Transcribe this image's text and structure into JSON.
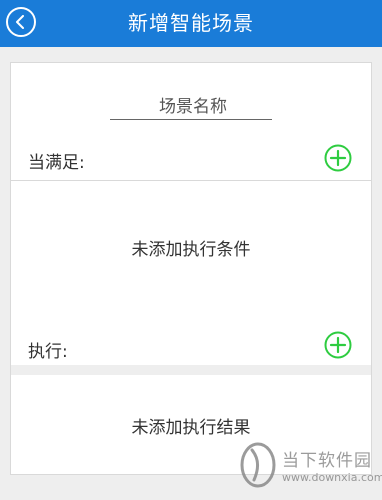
{
  "header": {
    "title": "新增智能场景",
    "back_icon": "chevron-left-icon"
  },
  "scene_name": {
    "placeholder": "场景名称",
    "value": ""
  },
  "condition": {
    "label": "当满足:",
    "add_icon": "plus-circle-icon",
    "empty_text": "未添加执行条件"
  },
  "action": {
    "label": "执行:",
    "add_icon": "plus-circle-icon",
    "empty_text": "未添加执行结果"
  },
  "watermark": {
    "title": "当下软件园",
    "url": "www.downxia.com"
  },
  "colors": {
    "header": "#1a7cd8",
    "add_green": "#2ecc40",
    "background": "#eeeeee"
  }
}
